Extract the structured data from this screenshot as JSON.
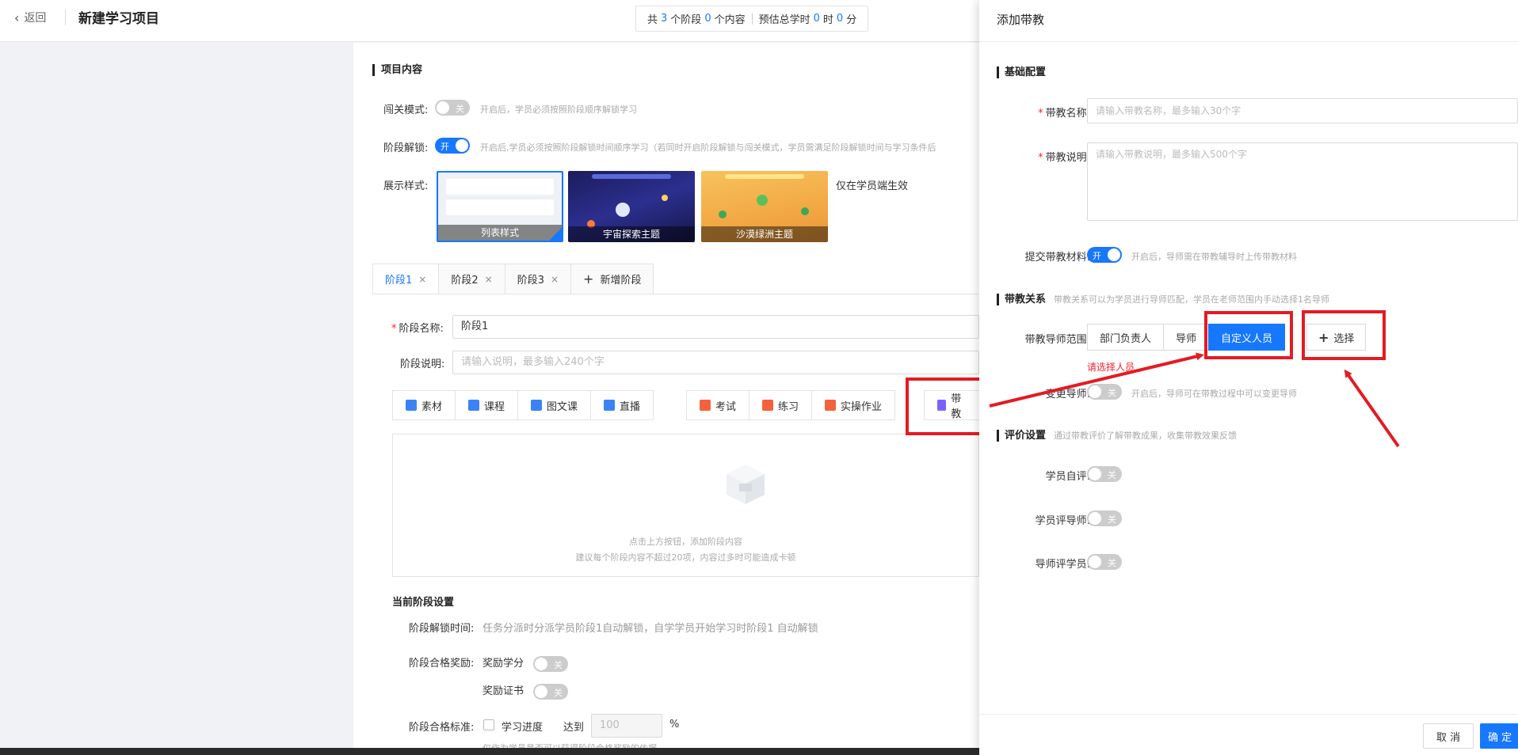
{
  "header": {
    "back_label": "返回",
    "title": "新建学习项目",
    "summary": {
      "prefix": "共",
      "stage_count": "3",
      "stage_unit": "个阶段",
      "content_count": "0",
      "content_unit": "个内容",
      "time_prefix": "预估总学时",
      "hours": "0",
      "hours_unit": "时",
      "minutes": "0",
      "minutes_unit": "分"
    }
  },
  "project": {
    "section_title": "项目内容",
    "gate_mode_label": "闯关模式:",
    "gate_mode_toggle": "关",
    "gate_mode_hint": "开启后，学员必须按照阶段顺序解锁学习",
    "stage_unlock_label": "阶段解锁:",
    "stage_unlock_toggle": "开",
    "stage_unlock_hint": "开启后,学员必须按照阶段解锁时间顺序学习（若同时开启阶段解锁与闯关模式，学员需满足阶段解锁时间与学习条件后",
    "display_style_label": "展示样式:",
    "styles": [
      "列表样式",
      "宇宙探索主题",
      "沙漠绿洲主题"
    ],
    "style_note": "仅在学员端生效"
  },
  "tabs": [
    {
      "label": "阶段1",
      "close": "×"
    },
    {
      "label": "阶段2",
      "close": "×"
    },
    {
      "label": "阶段3",
      "close": "×"
    }
  ],
  "add_stage": {
    "icon": "+",
    "label": "新增阶段"
  },
  "stage_form": {
    "name_label": "阶段名称:",
    "name_value": "阶段1",
    "desc_label": "阶段说明:",
    "desc_placeholder": "请输入说明，最多输入240个字"
  },
  "content_buttons_left": [
    "素材",
    "课程",
    "图文课",
    "直播"
  ],
  "content_buttons_right": [
    "考试",
    "练习",
    "实操作业"
  ],
  "mentor_button": "带教",
  "empty_state": {
    "line1": "点击上方按钮，添加阶段内容",
    "line2": "建议每个阶段内容不超过20项，内容过多时可能造成卡顿"
  },
  "stage_settings": {
    "title": "当前阶段设置",
    "unlock_time_label": "阶段解锁时间:",
    "unlock_time_value": "任务分派时分派学员阶段1自动解锁，自学学员开始学习时阶段1 自动解锁",
    "reward_label": "阶段合格奖励:",
    "reward_credit_label": "奖励学分",
    "reward_credit_toggle": "关",
    "reward_cert_label": "奖励证书",
    "reward_cert_toggle": "关",
    "pass_label": "阶段合格标准:",
    "pass_progress_label": "学习进度",
    "pass_reach_label": "达到",
    "pass_value_placeholder": "100",
    "pass_unit": "%",
    "pass_hint": "仅作为学员是否可以获得阶段合格奖励的依据"
  },
  "drawer": {
    "title": "添加带教",
    "basic_section": "基础配置",
    "name_label": "带教名称:",
    "name_placeholder": "请输入带教名称，最多输入30个字",
    "desc_label": "带教说明:",
    "desc_placeholder": "请输入带教说明，最多输入500个字",
    "submit_material_label": "提交带教材料:",
    "submit_material_toggle": "开",
    "submit_material_hint": "开启后，导师需在带教辅导时上传带教材料",
    "relation_section": "带教关系",
    "relation_hint": "带教关系可以为学员进行导师匹配，学员在老师范围内手动选择1名导师",
    "mentor_range_label": "带教导师范围:",
    "range_options": [
      "部门负责人",
      "导师",
      "自定义人员"
    ],
    "select_button": "选择",
    "select_icon": "+",
    "range_error": "请选择人员",
    "change_mentor_label": "变更导师:",
    "change_mentor_toggle": "关",
    "change_mentor_hint": "开启后，导师可在带教过程中可以变更导师",
    "eval_section": "评价设置",
    "eval_hint": "通过带教评价了解带教成果，收集带教效果反馈",
    "self_eval_label": "学员自评:",
    "self_eval_toggle": "关",
    "student_eval_mentor_label": "学员评导师:",
    "student_eval_mentor_toggle": "关",
    "mentor_eval_student_label": "导师评学员:",
    "mentor_eval_student_toggle": "关",
    "cancel_button": "取 消",
    "confirm_button": "确 定"
  },
  "colors": {
    "primary": "#1677ff",
    "annotation": "#e31b23",
    "error": "#f5222d"
  }
}
